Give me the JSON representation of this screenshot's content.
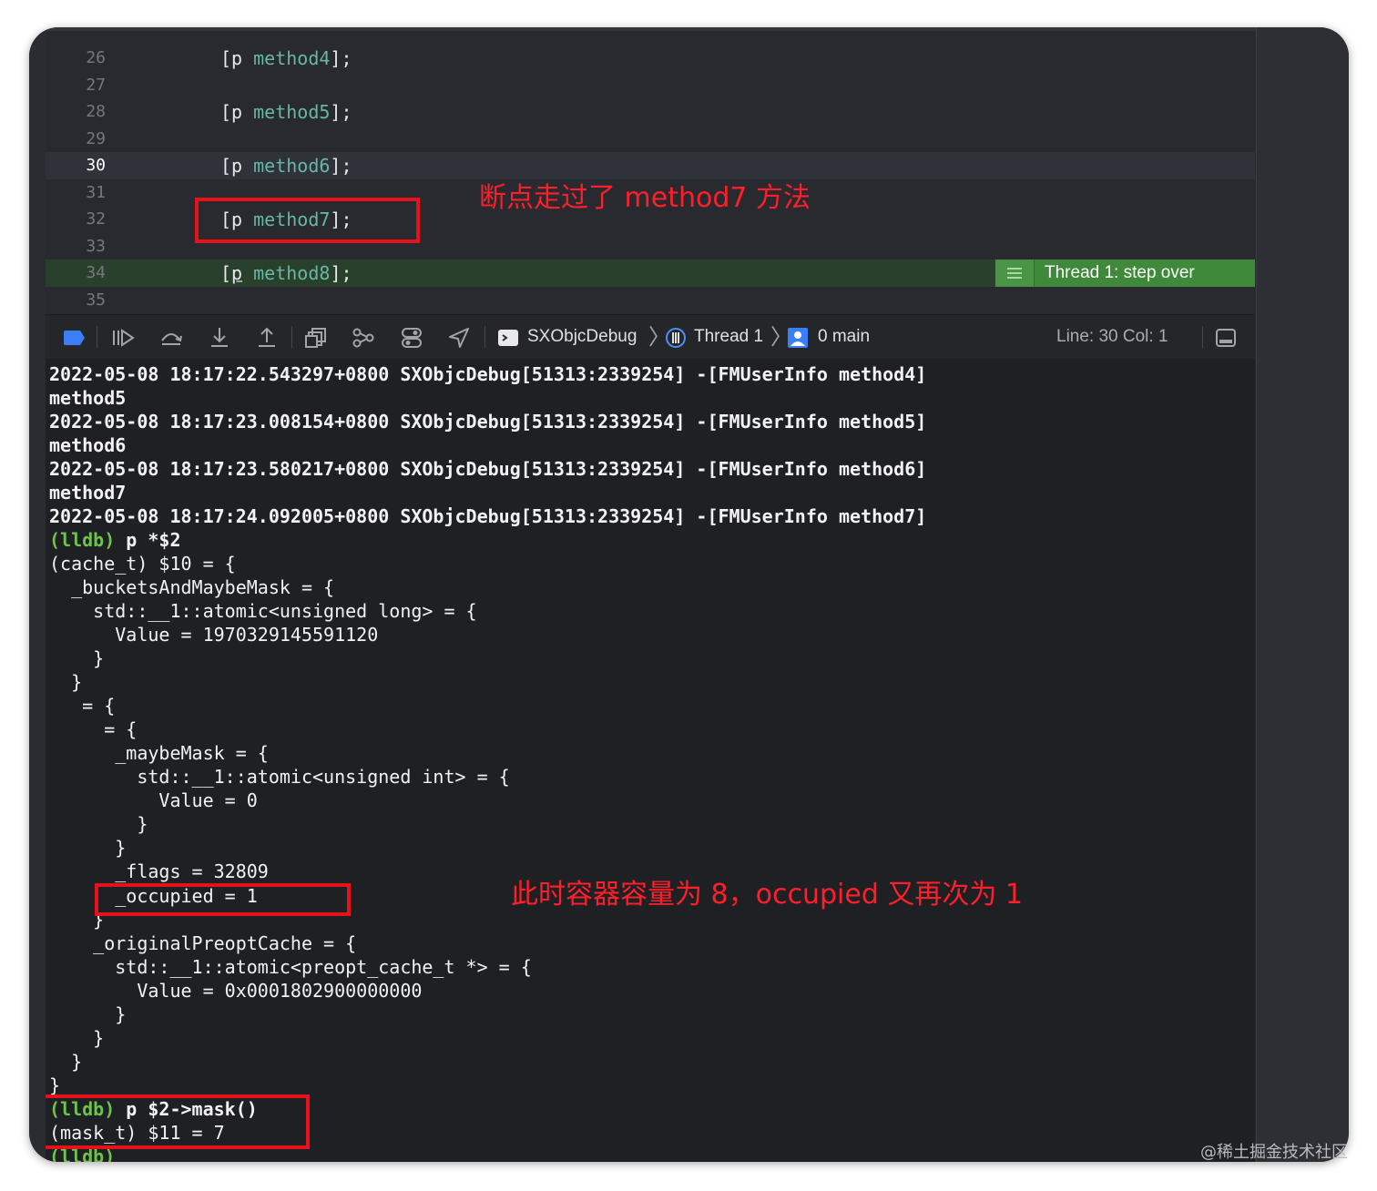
{
  "editor": {
    "lines": [
      {
        "num": "26",
        "prefix": "[p ",
        "method": "method4",
        "suffix": "];"
      },
      {
        "num": "27",
        "prefix": "",
        "method": "",
        "suffix": ""
      },
      {
        "num": "28",
        "prefix": "[p ",
        "method": "method5",
        "suffix": "];"
      },
      {
        "num": "29",
        "prefix": "",
        "method": "",
        "suffix": ""
      },
      {
        "num": "30",
        "prefix": "[p ",
        "method": "method6",
        "suffix": "];"
      },
      {
        "num": "31",
        "prefix": "",
        "method": "",
        "suffix": ""
      },
      {
        "num": "32",
        "prefix": "[p ",
        "method": "method7",
        "suffix": "];"
      },
      {
        "num": "33",
        "prefix": "",
        "method": "",
        "suffix": ""
      },
      {
        "num": "34",
        "prefix": "[",
        "p": "p",
        "space": " ",
        "method": "method8",
        "suffix": "];"
      },
      {
        "num": "35",
        "prefix": "",
        "method": "",
        "suffix": ""
      }
    ],
    "step_badge": "Thread 1: step over",
    "annotation_top": "断点走过了 method7 方法"
  },
  "debug_bar": {
    "scheme": "SXObjcDebug",
    "thread": "Thread 1",
    "frame": "0 main",
    "line_col": "Line: 30  Col: 1"
  },
  "console": {
    "lines": [
      {
        "text": "2022-05-08 18:17:22.543297+0800 SXObjcDebug[51313:2339254] -[FMUserInfo method4]",
        "bold": true
      },
      {
        "text": "method5",
        "bold": true
      },
      {
        "text": "2022-05-08 18:17:23.008154+0800 SXObjcDebug[51313:2339254] -[FMUserInfo method5]",
        "bold": true
      },
      {
        "text": "method6",
        "bold": true
      },
      {
        "text": "2022-05-08 18:17:23.580217+0800 SXObjcDebug[51313:2339254] -[FMUserInfo method6]",
        "bold": true
      },
      {
        "text": "method7",
        "bold": true
      },
      {
        "text": "2022-05-08 18:17:24.092005+0800 SXObjcDebug[51313:2339254] -[FMUserInfo method7]",
        "bold": true
      },
      {
        "prompt": "(lldb)",
        "text": " p *$2",
        "bold": true
      },
      {
        "text": "(cache_t) $10 = {"
      },
      {
        "text": "  _bucketsAndMaybeMask = {"
      },
      {
        "text": "    std::__1::atomic<unsigned long> = {"
      },
      {
        "text": "      Value = 1970329145591120"
      },
      {
        "text": "    }"
      },
      {
        "text": "  }"
      },
      {
        "text": "   = {"
      },
      {
        "text": "     = {"
      },
      {
        "text": "      _maybeMask = {"
      },
      {
        "text": "        std::__1::atomic<unsigned int> = {"
      },
      {
        "text": "          Value = 0"
      },
      {
        "text": "        }"
      },
      {
        "text": "      }"
      },
      {
        "text": "      _flags = 32809"
      },
      {
        "text": "      _occupied = 1"
      },
      {
        "text": "    }"
      },
      {
        "text": "    _originalPreoptCache = {"
      },
      {
        "text": "      std::__1::atomic<preopt_cache_t *> = {"
      },
      {
        "text": "        Value = 0x0001802900000000"
      },
      {
        "text": "      }"
      },
      {
        "text": "    }"
      },
      {
        "text": "  }"
      },
      {
        "text": "}"
      },
      {
        "prompt": "(lldb)",
        "text": " p $2->mask()",
        "bold": true
      },
      {
        "text": "(mask_t) $11 = 7"
      },
      {
        "prompt": "(lldb)",
        "text": ""
      }
    ],
    "annotation_mid": "此时容器容量为 8，occupied 又再次为 1"
  },
  "watermark": "@稀土掘金技术社区",
  "colors": {
    "annotation": "#e8111a",
    "lldb_prompt": "#6ec34b",
    "method_token": "#67b7a4",
    "step_badge": "#3f8a3a"
  }
}
